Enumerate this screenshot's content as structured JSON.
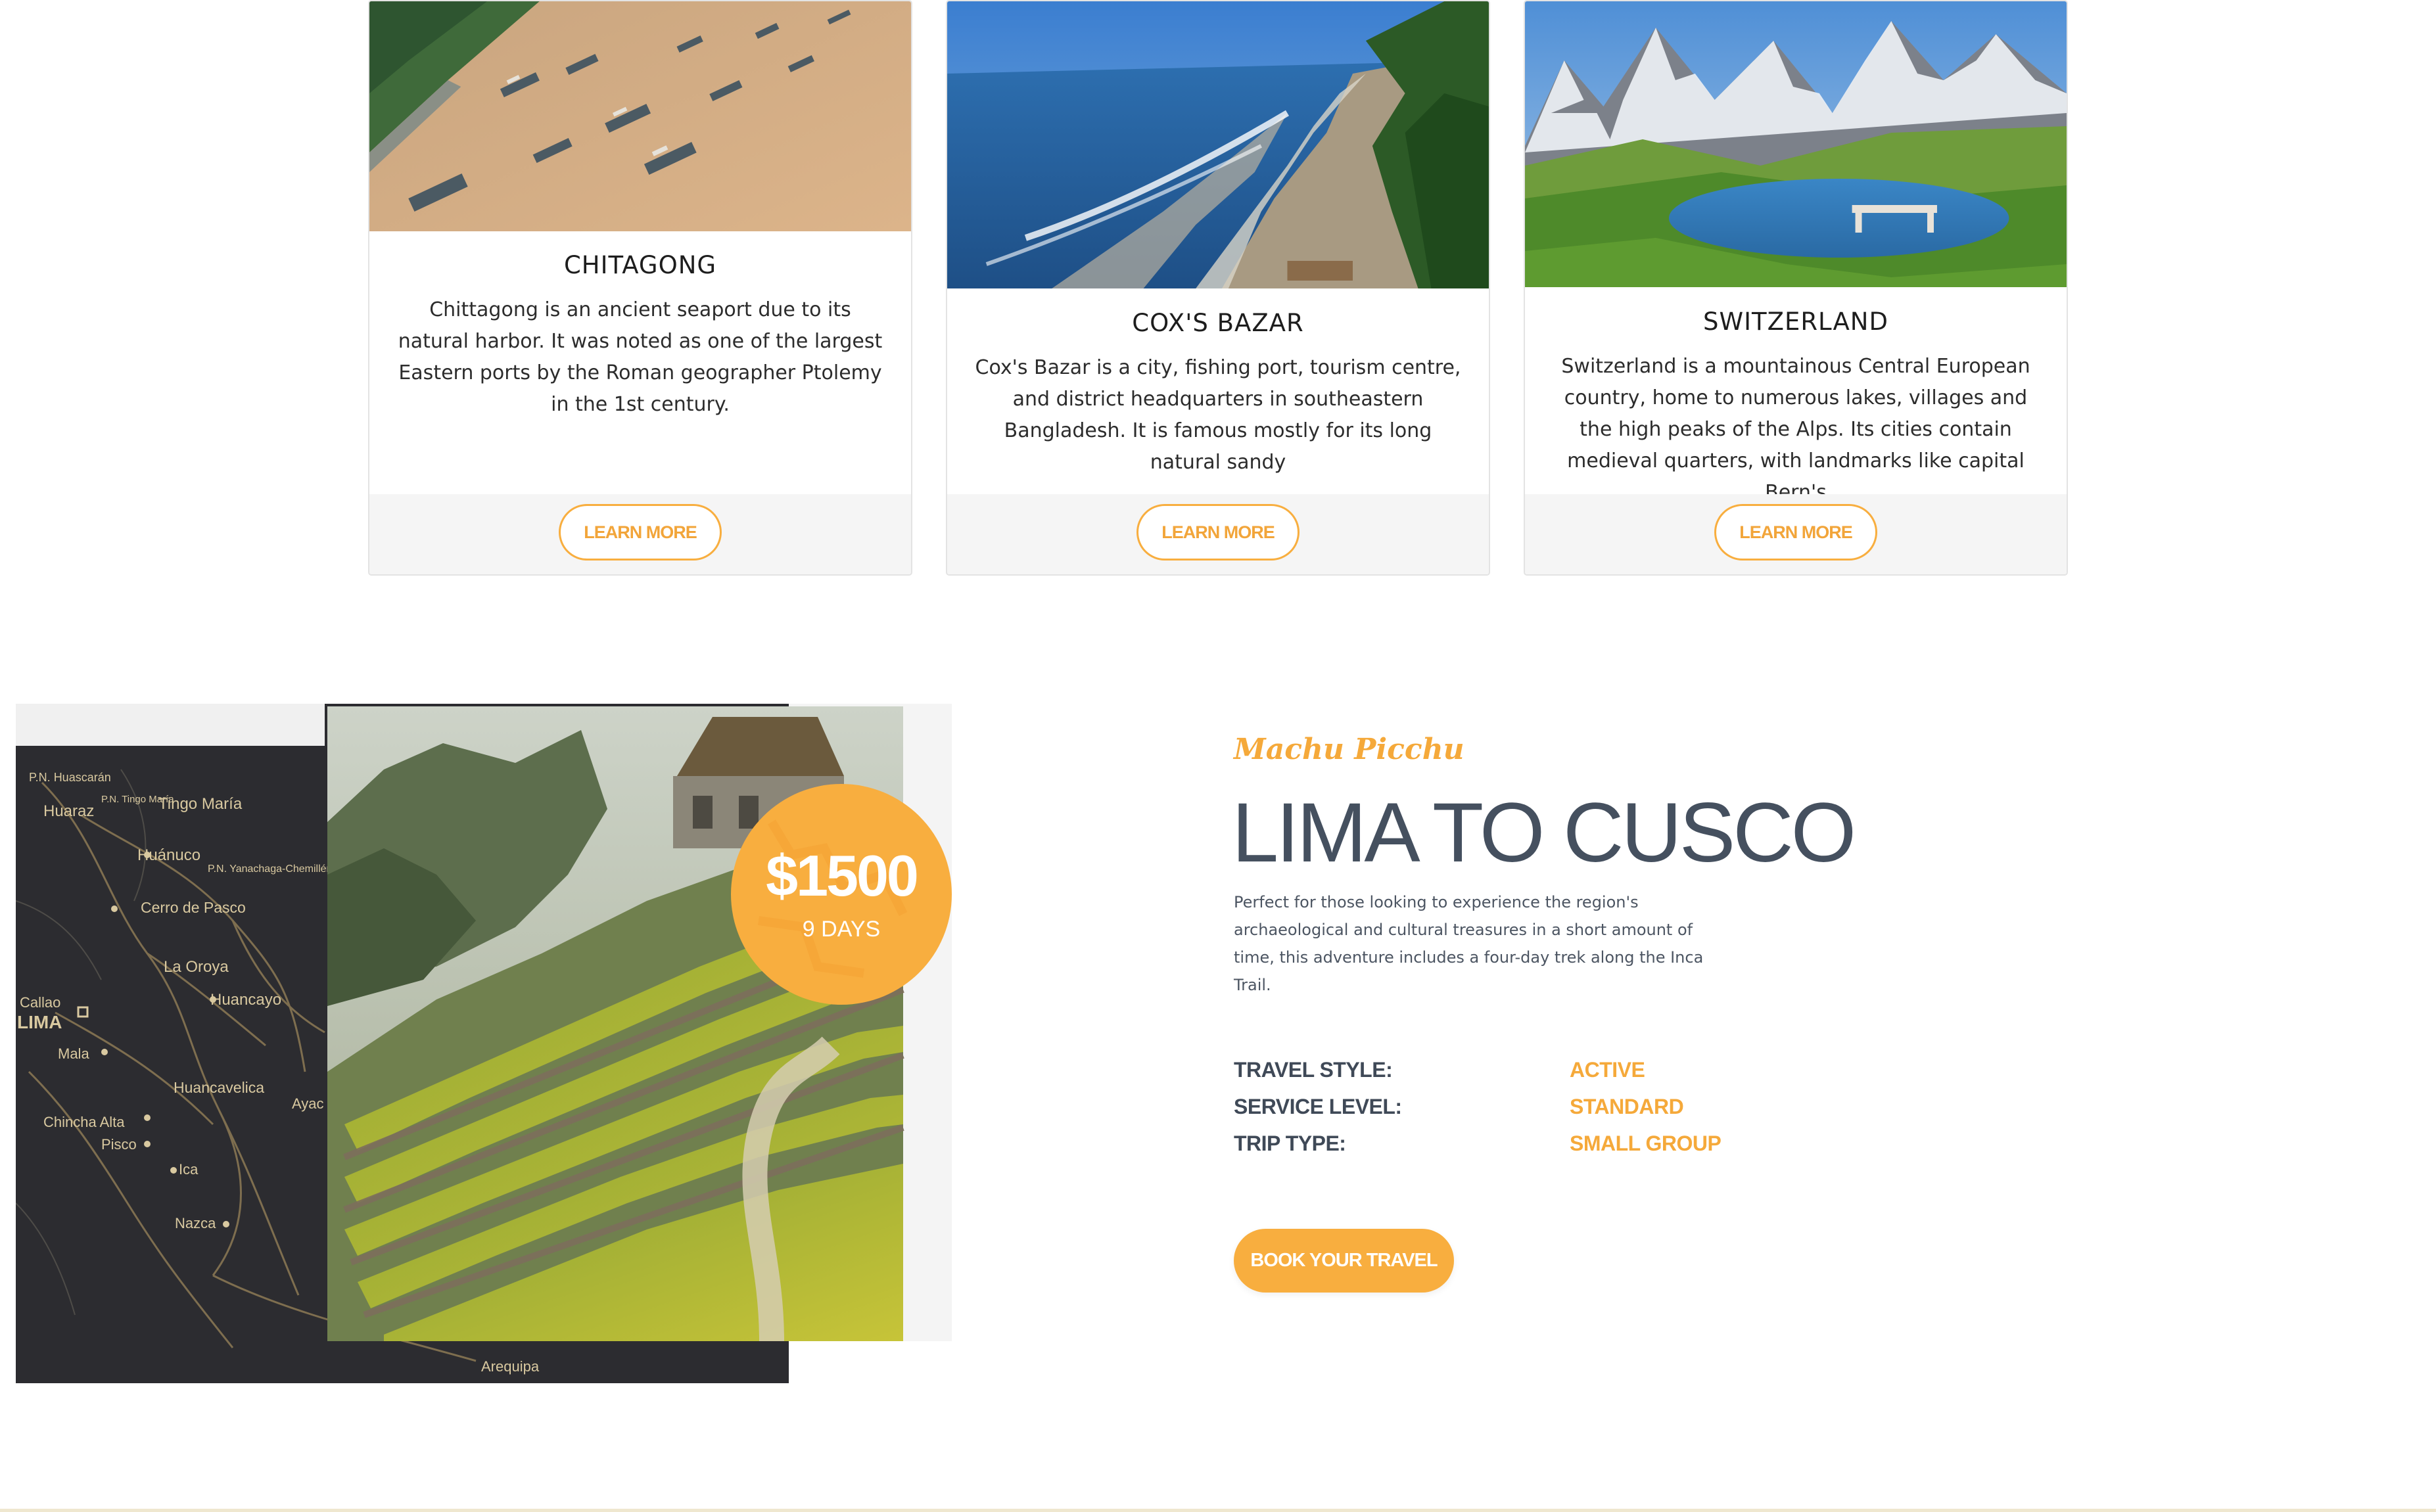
{
  "cards": [
    {
      "title": "CHITAGONG",
      "text": "Chittagong is an ancient seaport due to its natural harbor. It was noted as one of the largest Eastern ports by the Roman geographer Ptolemy in the 1st century.",
      "button": "LEARN MORE"
    },
    {
      "title": "COX'S BAZAR",
      "text": "Cox's Bazar is a city, fishing port, tourism centre, and district headquarters in southeastern Bangladesh. It is famous mostly for its long natural sandy",
      "button": "LEARN MORE"
    },
    {
      "title": "SWITZERLAND",
      "text": "Switzerland is a mountainous Central European country, home to numerous lakes, villages and the high peaks of the Alps. Its cities contain medieval quarters, with landmarks like capital Bern's",
      "button": "LEARN MORE"
    }
  ],
  "tour": {
    "subtitle": "Machu Picchu",
    "title": "LIMA TO CUSCO",
    "description": "Perfect for those looking to experience the region's archaeological and cultural treasures in a short amount of time, this adventure includes a four-day trek along the Inca Trail.",
    "price": "$1500",
    "duration": "9 DAYS",
    "details": [
      {
        "label": "TRAVEL STYLE:",
        "value": "ACTIVE"
      },
      {
        "label": "SERVICE LEVEL:",
        "value": "STANDARD"
      },
      {
        "label": "TRIP TYPE:",
        "value": "SMALL GROUP"
      }
    ],
    "book_button": "BOOK YOUR TRAVEL",
    "map_labels": [
      "P.N. Huascarán",
      "Huaraz",
      "P.N. Tingo María",
      "Tingo María",
      "Huánuco",
      "P.N. Yanachaga-Chemillén",
      "Cerro de Pasco",
      "La Oroya",
      "Huancayo",
      "Callao",
      "LIMA",
      "Mala",
      "Huancavelica",
      "Ayac",
      "Chincha Alta",
      "Pisco",
      "Ica",
      "Nazca",
      "Arequipa"
    ]
  },
  "colors": {
    "accent": "#f8ae3f",
    "heading": "#45505f",
    "map": "#2c2c30"
  }
}
